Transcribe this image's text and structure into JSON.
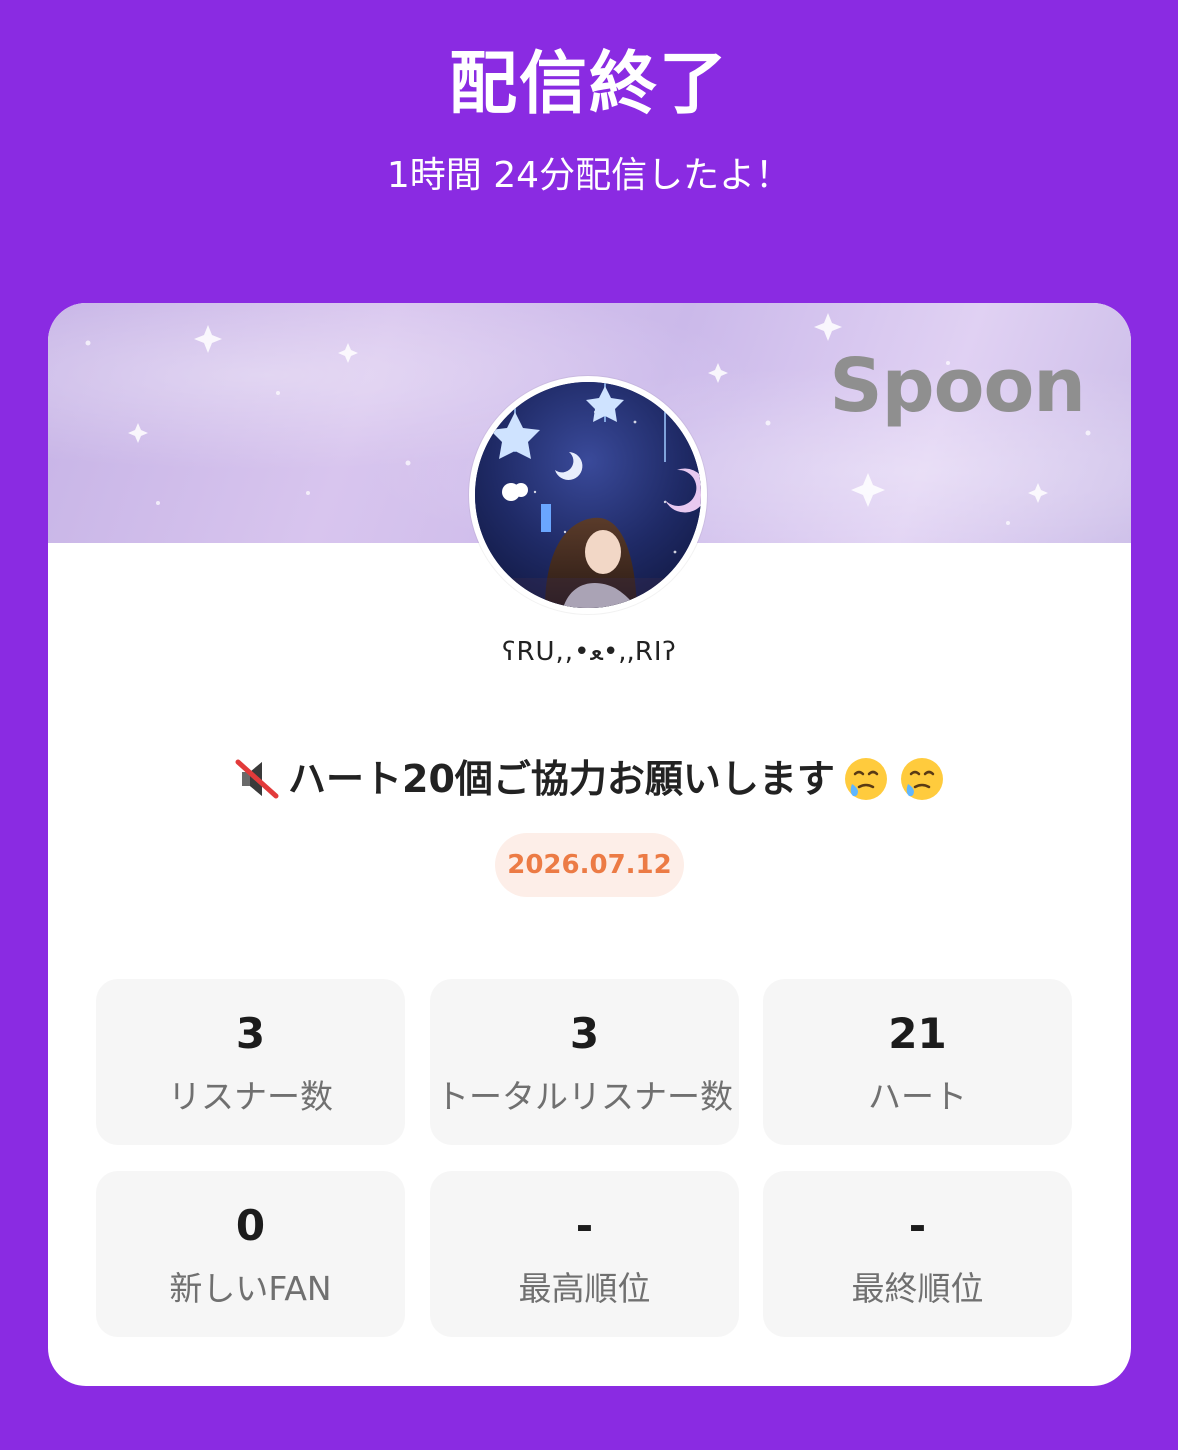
{
  "header": {
    "title": "配信終了",
    "subtitle": "1時間 24分配信したよ！"
  },
  "card": {
    "brand": "Spoon",
    "username": "ʕRU,,•ﻌ•,,RIʔ",
    "room_title": "ハート20個ご協力お願いします",
    "leading_icon": "muted-speaker-icon",
    "trailing_icons": [
      "face-holding-back-tears-icon",
      "face-holding-back-tears-icon"
    ],
    "date": "2026.07.12"
  },
  "stats": [
    {
      "value": "3",
      "label": "リスナー数"
    },
    {
      "value": "3",
      "label": "トータルリスナー数"
    },
    {
      "value": "21",
      "label": "ハート"
    },
    {
      "value": "0",
      "label": "新しいFAN"
    },
    {
      "value": "-",
      "label": "最高順位"
    },
    {
      "value": "-",
      "label": "最終順位"
    }
  ],
  "colors": {
    "background": "#8a2be2",
    "card": "#ffffff",
    "stat_tile": "#f6f6f6",
    "date_text": "#ec7b45",
    "date_badge": "#fdeee8",
    "brand_logo": "#8f8f8f"
  }
}
